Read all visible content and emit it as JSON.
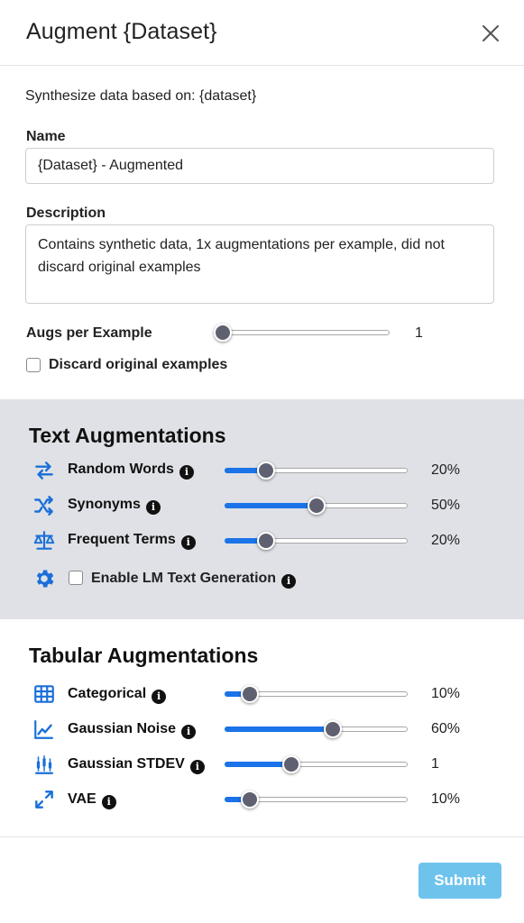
{
  "header": {
    "title": "Augment {Dataset}"
  },
  "intro": "Synthesize data based on: {dataset}",
  "name_field": {
    "label": "Name",
    "value": "{Dataset} - Augmented"
  },
  "description_field": {
    "label": "Description",
    "value": "Contains synthetic data, 1x augmentations per example, did not discard original examples"
  },
  "augs_per_example": {
    "label": "Augs per Example",
    "value": "1",
    "fraction": 0.0
  },
  "discard_original": {
    "label": "Discard original examples",
    "checked": false
  },
  "text_augmentations": {
    "title": "Text Augmentations",
    "items": [
      {
        "label": "Random Words",
        "icon": "swap-arrows-icon",
        "value": "20%",
        "fraction": 0.2
      },
      {
        "label": "Synonyms",
        "icon": "shuffle-icon",
        "value": "50%",
        "fraction": 0.5
      },
      {
        "label": "Frequent Terms",
        "icon": "scale-balance-icon",
        "value": "20%",
        "fraction": 0.2
      }
    ],
    "lm_generation": {
      "label": "Enable LM Text Generation",
      "icon": "gear-icon",
      "checked": false
    }
  },
  "tabular_augmentations": {
    "title": "Tabular Augmentations",
    "items": [
      {
        "label": "Categorical",
        "icon": "grid-icon",
        "value": "10%",
        "fraction": 0.1
      },
      {
        "label": "Gaussian Noise",
        "icon": "line-chart-icon",
        "value": "60%",
        "fraction": 0.6
      },
      {
        "label": "Gaussian STDEV",
        "icon": "candlestick-chart-icon",
        "value": "1",
        "fraction": 0.35
      },
      {
        "label": "VAE",
        "icon": "expand-arrows-icon",
        "value": "10%",
        "fraction": 0.1
      }
    ]
  },
  "footer": {
    "submit_label": "Submit"
  },
  "colors": {
    "accent": "#1a73e8",
    "submit_bg": "#6ec3ec",
    "section_bg": "#dfe1e6",
    "icon_blue": "#1a6fd8"
  }
}
